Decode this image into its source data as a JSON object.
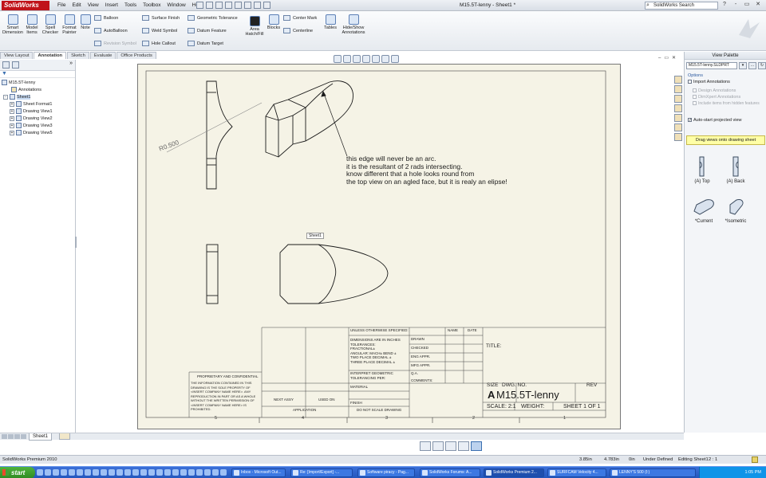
{
  "app": {
    "logo": "SolidWorks",
    "doc_title": "M15.5T-lenny - Sheet1 *",
    "search_placeholder": "SolidWorks Search"
  },
  "menu": [
    "File",
    "Edit",
    "View",
    "Insert",
    "Tools",
    "Toolbox",
    "Window",
    "Help"
  ],
  "window_buttons": [
    "?",
    "-",
    "▭",
    "✕"
  ],
  "ribbon": {
    "smart_dimension": [
      "Smart",
      "Dimension"
    ],
    "model_items": [
      "Model",
      "Items"
    ],
    "spell_checker": [
      "Spell",
      "Checker"
    ],
    "format_painter": [
      "Format",
      "Painter"
    ],
    "note": "Note",
    "balloon": "Balloon",
    "autoballoon": "AutoBalloon",
    "revision_symbol": "Revision Symbol",
    "surface_finish": "Surface Finish",
    "weld_symbol": "Weld Symbol",
    "hole_callout": "Hole Callout",
    "geometric_tolerance": "Geometric Tolerance",
    "datum_feature": "Datum Feature",
    "datum_target": "Datum Target",
    "area_hatch": [
      "Area",
      "Hatch/Fill"
    ],
    "blocks": "Blocks",
    "center_mark": "Center Mark",
    "centerline": "Centerline",
    "tables": "Tables",
    "hide_show": [
      "Hide/Show",
      "Annotations"
    ]
  },
  "tabs": [
    "View Layout",
    "Annotation",
    "Sketch",
    "Evaluate",
    "Office Products"
  ],
  "tree": {
    "root": "M15.5T-lenny",
    "items": [
      "Annotations",
      "Sheet1",
      "Sheet Format1",
      "Drawing View1",
      "Drawing View2",
      "Drawing View3",
      "Drawing View5"
    ]
  },
  "drawing": {
    "radius_label": "R0.500",
    "note_lines": [
      "this edge will never be an arc.",
      "it is the resultant of 2 rads intersecting.",
      "know different that a hole looks round from",
      "the top view on an agled face, but it is realy an elipse!"
    ],
    "sheet_tag": "Sheet1",
    "zones": [
      "5",
      "4",
      "3",
      "2",
      "1"
    ],
    "title_block": {
      "unless": "UNLESS OTHERWISE SPECIFIED:",
      "name": "NAME",
      "date": "DATE",
      "drawn": "DRAWN",
      "checked": "CHECKED",
      "eng_appr": "ENG APPR.",
      "mfg_appr": "MFG APPR.",
      "qa": "Q.A.",
      "comments": "COMMENTS:",
      "dims": [
        "DIMENSIONS ARE IN INCHES",
        "TOLERANCES:",
        "FRACTIONAL±",
        "ANGULAR: MACH±   BEND ±",
        "TWO PLACE DECIMAL    ±",
        "THREE PLACE DECIMAL  ±"
      ],
      "interpret": [
        "INTERPRET GEOMETRIC",
        "TOLERANCING PER:"
      ],
      "material": "MATERIAL",
      "finish": "FINISH",
      "next_assy": "NEXT ASSY",
      "used_on": "USED ON",
      "application": "APPLICATION",
      "do_not_scale": "DO NOT SCALE DRAWING",
      "proprietary": "PROPRIETARY AND CONFIDENTIAL",
      "prop_text": [
        "THE INFORMATION CONTAINED IN THIS",
        "DRAWING IS THE SOLE PROPERTY OF",
        "<INSERT COMPANY NAME HERE>. ANY",
        "REPRODUCTION IN PART OR AS A WHOLE",
        "WITHOUT THE WRITTEN PERMISSION OF",
        "<INSERT COMPANY NAME HERE> IS",
        "PROHIBITED."
      ],
      "title": "TITLE:",
      "size_label": "SIZE",
      "size_value": "A",
      "dwg_no_label": "DWG.  NO.",
      "dwg_no": "M15.5T-lenny",
      "rev": "REV",
      "scale": "SCALE: 2:1",
      "weight": "WEIGHT:",
      "sheet": "SHEET 1 OF 1"
    }
  },
  "sheet_tabs": {
    "sheet1": "Sheet1"
  },
  "palette": {
    "title": "View Palette",
    "file": "M15.5T-lenny.SLDPRT",
    "options": "Options",
    "import_annotations": "Import Annotations",
    "design_annotations": "Design Annotations",
    "dimxpert_annotations": "DimXpert Annotations",
    "include_hidden": "Include items from hidden features",
    "auto_start": "Auto-start projected view",
    "drag_hint": "Drag views onto drawing sheet",
    "views": [
      "(A) Top",
      "(A) Back",
      "*Current",
      "*Isometric"
    ]
  },
  "status": {
    "product": "SolidWorks Premium 2010",
    "x": "3.85in",
    "y": "4.783in",
    "z": "0in",
    "defined": "Under Defined",
    "editing": "Editing Sheet1",
    "scale": "2 : 1"
  },
  "taskbar": {
    "start": "start",
    "tasks": [
      "Inbox - Microsoft Out...",
      "Re: [Import/Export] -...",
      "Software piracy - Pag...",
      "SolidWorks Forums: A...",
      "SolidWorks Premium 2...",
      "SURFCAM Velocity 4...",
      "LENNY'S 500 (I:)"
    ],
    "clock": "1:05 PM"
  }
}
